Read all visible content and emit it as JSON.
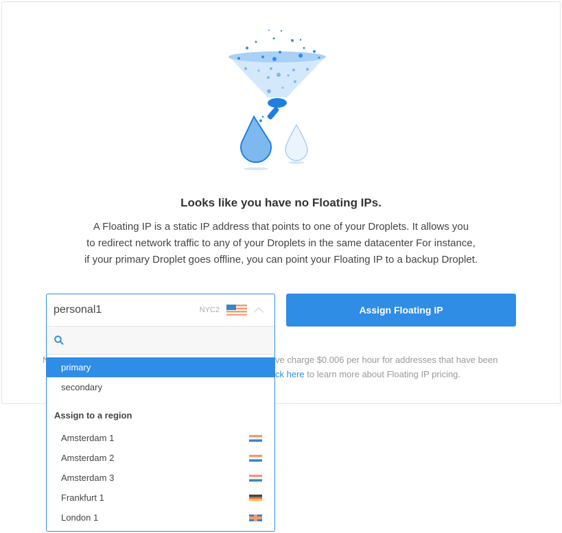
{
  "empty_state": {
    "title": "Looks like you have no Floating IPs.",
    "description": [
      "A Floating IP is a static IP address that points to one of your Droplets. It allows you",
      "to redirect network traffic to any of your Droplets in the same datacenter For instance,",
      "if your primary Droplet goes offline, you can point your Floating IP to a backup Droplet."
    ],
    "note_line1_start": "N",
    "note_line1_end": "ve charge $0.006 per hour for addresses that have been",
    "note_link": "ck here",
    "note_line2_rest": " to learn more about Floating IP pricing."
  },
  "assign_button": "Assign Floating IP",
  "dropdown": {
    "selected": "personal1",
    "selected_region": "NYC2",
    "selected_flag": "us",
    "search_placeholder": "",
    "droplets": [
      {
        "label": "primary",
        "highlighted": true
      },
      {
        "label": "secondary",
        "highlighted": false
      }
    ],
    "region_group_label": "Assign to a region",
    "regions": [
      {
        "label": "Amsterdam 1",
        "flag": "nl"
      },
      {
        "label": "Amsterdam 2",
        "flag": "nl"
      },
      {
        "label": "Amsterdam 3",
        "flag": "nl"
      },
      {
        "label": "Frankfurt 1",
        "flag": "de"
      },
      {
        "label": "London 1",
        "flag": "uk"
      }
    ]
  },
  "colors": {
    "accent": "#2f8de6",
    "illustration_light": "#a9d0f5"
  }
}
